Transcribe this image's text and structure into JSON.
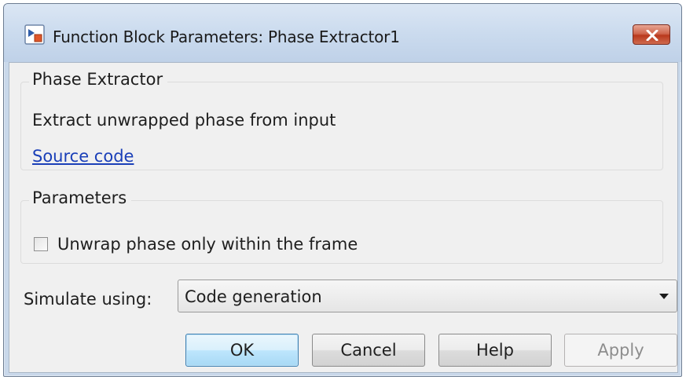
{
  "window": {
    "title": "Function Block Parameters: Phase Extractor1",
    "close_icon": "close-x-icon",
    "app_icon": "simulink-block-icon"
  },
  "description_group": {
    "title": "Phase Extractor",
    "description": "Extract unwrapped phase from input",
    "link_label": "Source code"
  },
  "parameters_group": {
    "title": "Parameters",
    "checkbox_label": "Unwrap phase only within the frame",
    "checkbox_checked": false
  },
  "simulate": {
    "label": "Simulate using:",
    "selected": "Code generation"
  },
  "buttons": {
    "ok": "OK",
    "cancel": "Cancel",
    "help": "Help",
    "apply": "Apply"
  },
  "colors": {
    "link": "#1a3fb8",
    "close_button": "#c8503a",
    "default_button_border": "#3c7fb1"
  }
}
